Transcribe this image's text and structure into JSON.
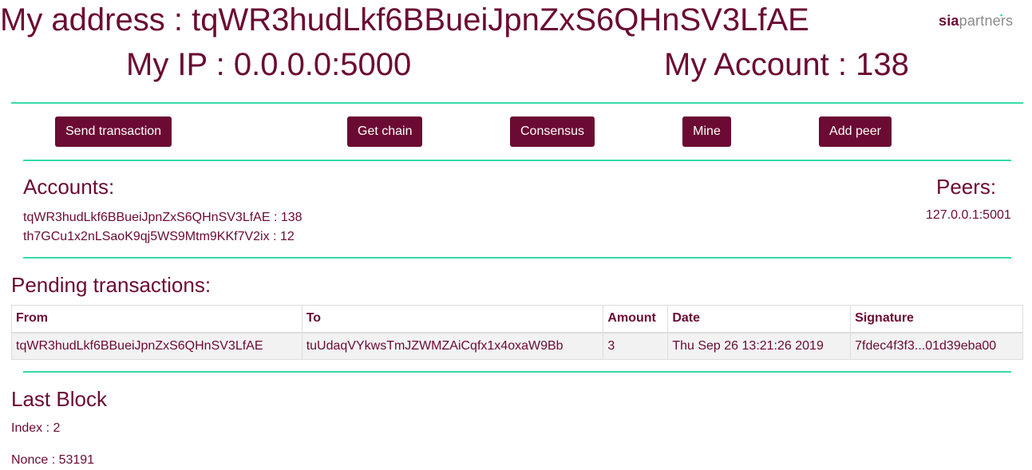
{
  "header": {
    "address_label": "My address : tqWR3hudLkf6BBueiJpnZxS6QHnSV3LfAE",
    "ip_label": "My IP : 0.0.0.0:5000",
    "account_label": "My Account : 138",
    "logo_part1": "sia",
    "logo_part2": "partners",
    "logo_dot": "▪"
  },
  "toolbar": {
    "send_transaction": "Send transaction",
    "get_chain": "Get chain",
    "consensus": "Consensus",
    "mine": "Mine",
    "add_peer": "Add peer"
  },
  "accounts": {
    "title": "Accounts:",
    "items": [
      "tqWR3hudLkf6BBueiJpnZxS6QHnSV3LfAE : 138",
      "th7GCu1x2nLSaoK9qj5WS9Mtm9KKf7V2ix : 12"
    ]
  },
  "peers": {
    "title": "Peers:",
    "items": [
      "127.0.0.1:5001"
    ]
  },
  "pending": {
    "title": "Pending transactions:",
    "columns": [
      "From",
      "To",
      "Amount",
      "Date",
      "Signature"
    ],
    "rows": [
      [
        "tqWR3hudLkf6BBueiJpnZxS6QHnSV3LfAE",
        "tuUdaqVYkwsTmJZWMZAiCqfx1x4oxaW9Bb",
        "3",
        "Thu Sep 26 13:21:26 2019",
        "7fdec4f3f3...01d39eba00"
      ]
    ]
  },
  "last_block": {
    "title": "Last Block",
    "index_line": "Index : 2",
    "nonce_line": "Nonce : 53191"
  },
  "colors": {
    "brand": "#6b0a32",
    "accent_rule": "#33dba8",
    "row_bg": "#f2f2f2"
  }
}
